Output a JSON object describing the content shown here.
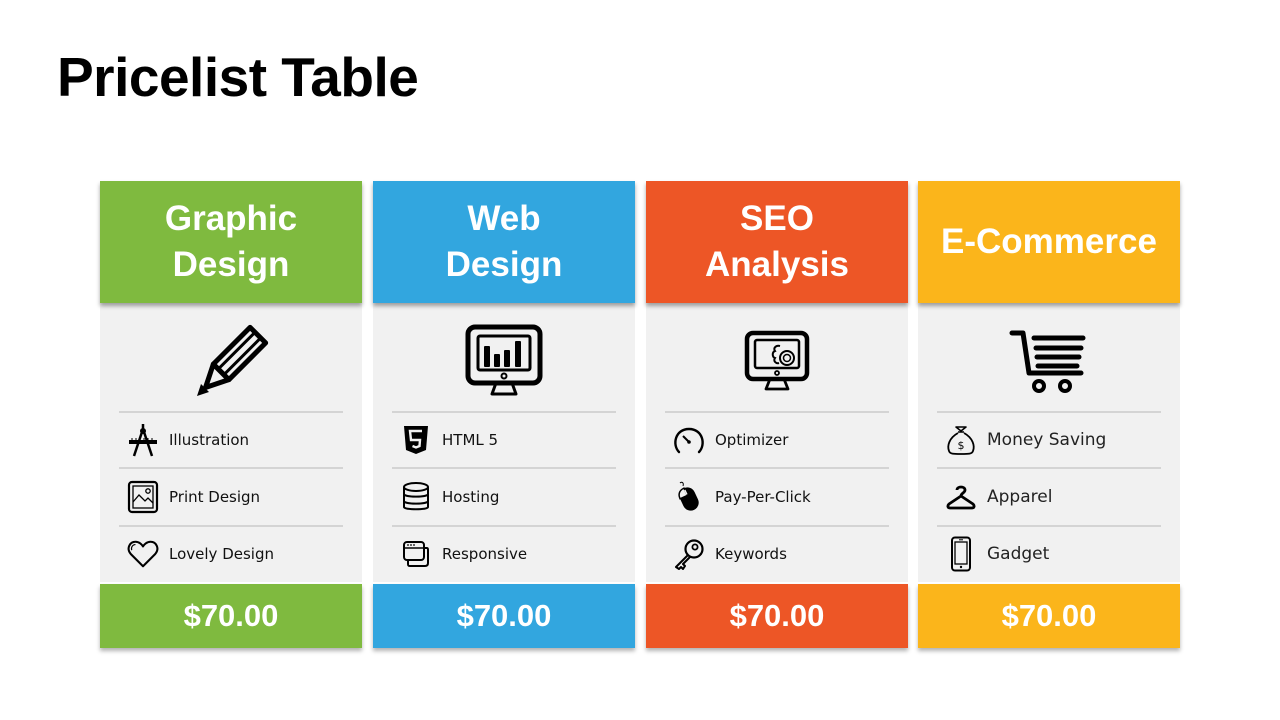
{
  "title": "Pricelist Table",
  "colors": {
    "green": "#7fba3f",
    "blue": "#32a6df",
    "orange": "#ed5626",
    "yellow": "#fbb51b",
    "panel": "#f1f1f1"
  },
  "cards": [
    {
      "name": "Graphic\nDesign",
      "hero_icon": "pencil-icon",
      "price": "$70.00",
      "features": [
        {
          "icon": "compass-ruler-icon",
          "label": "Illustration"
        },
        {
          "icon": "picture-frame-icon",
          "label": "Print Design"
        },
        {
          "icon": "heart-icon",
          "label": "Lovely Design"
        }
      ]
    },
    {
      "name": "Web\nDesign",
      "hero_icon": "monitor-bar-chart-icon",
      "price": "$70.00",
      "features": [
        {
          "icon": "html5-icon",
          "label": "HTML 5"
        },
        {
          "icon": "database-icon",
          "label": "Hosting"
        },
        {
          "icon": "browser-windows-icon",
          "label": "Responsive"
        }
      ]
    },
    {
      "name": "SEO\nAnalysis",
      "hero_icon": "monitor-gears-icon",
      "price": "$70.00",
      "features": [
        {
          "icon": "speedometer-icon",
          "label": "Optimizer"
        },
        {
          "icon": "mouse-icon",
          "label": "Pay-Per-Click"
        },
        {
          "icon": "key-icon",
          "label": "Keywords"
        }
      ]
    },
    {
      "name": "E-Commerce",
      "hero_icon": "shopping-cart-icon",
      "price": "$70.00",
      "features": [
        {
          "icon": "money-bag-icon",
          "label": "Money Saving"
        },
        {
          "icon": "hanger-icon",
          "label": "Apparel"
        },
        {
          "icon": "smartphone-icon",
          "label": "Gadget"
        }
      ]
    }
  ]
}
